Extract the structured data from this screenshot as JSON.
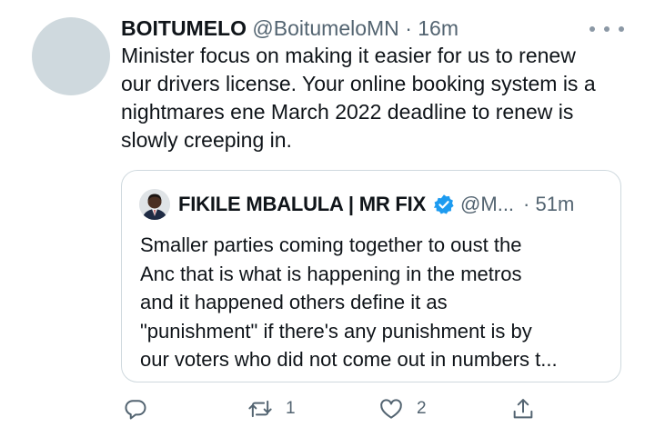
{
  "tweet": {
    "display_name": "BOITUMELO",
    "handle": "@BoitumeloMN",
    "separator": "·",
    "time": "16m",
    "text_lines": [
      "Minister focus on making it easier for us to renew",
      "our drivers license. Your online booking system is a",
      "nightmares ene March 2022 deadline to renew is",
      "slowly creeping in."
    ]
  },
  "quote": {
    "display_name": "FIKILE MBALULA | MR FIX",
    "handle": "@M...",
    "time": "· 51m",
    "verified": true,
    "text_lines": [
      "Smaller parties coming together to oust the",
      "Anc that is what is happening in the metros",
      "and it happened others define it as",
      "\"punishment\" if there's any punishment is by",
      "our voters who did not come out in numbers t..."
    ]
  },
  "actions": {
    "reply_count": "",
    "retweet_count": "1",
    "like_count": "2"
  },
  "icons": {
    "more": "more-dots-icon",
    "verified": "verified-badge-icon",
    "reply": "reply-icon",
    "retweet": "retweet-icon",
    "like": "heart-icon",
    "share": "share-icon"
  },
  "colors": {
    "text": "#0f1419",
    "muted": "#536471",
    "verified": "#1d9bf0",
    "border": "#cfd9de",
    "avatar_placeholder": "#cfd9de"
  }
}
